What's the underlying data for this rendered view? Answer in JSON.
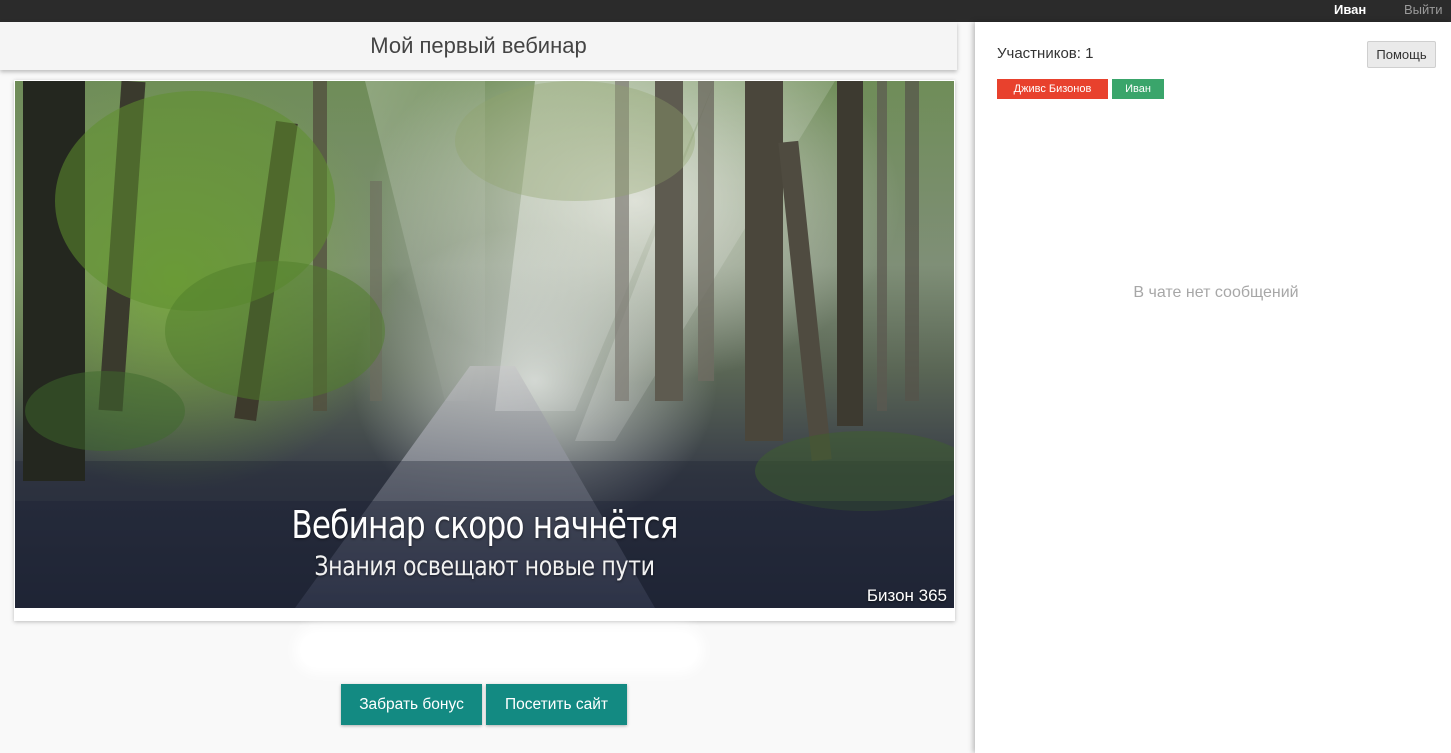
{
  "topbar": {
    "user_name": "Иван",
    "logout_label": "Выйти"
  },
  "webinar": {
    "title": "Мой первый вебинар",
    "video": {
      "headline": "Вебинар скоро начнётся",
      "subline": "Знания освещают новые пути",
      "brand": "Бизон 365"
    }
  },
  "actions": {
    "bonus_label": "Забрать бонус",
    "site_label": "Посетить сайт",
    "accent_color": "#138a82"
  },
  "chat": {
    "participants_label": "Участников: 1",
    "help_label": "Помощь",
    "tags": [
      {
        "label": "Дживс Бизонов",
        "color": "#e8412d"
      },
      {
        "label": "Иван",
        "color": "#3aa56b"
      }
    ],
    "empty_text": "В чате нет сообщений"
  }
}
